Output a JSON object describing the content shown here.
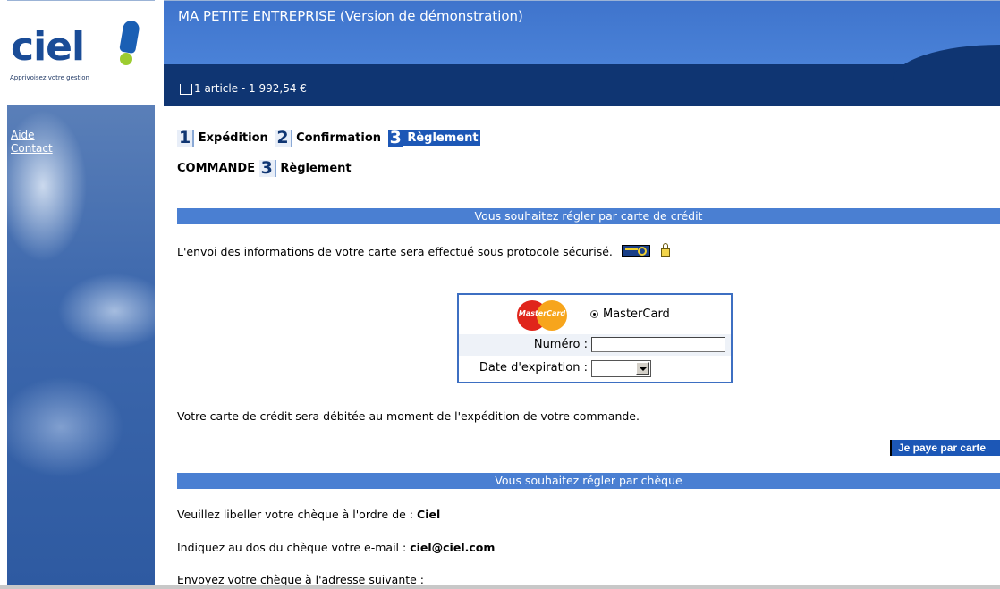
{
  "logo": {
    "word": "ciel",
    "tagline": "Apprivoisez votre gestion"
  },
  "header": {
    "title": "MA PETITE ENTREPRISE (Version de démonstration)",
    "cart": "1 article - 1 992,54 €"
  },
  "sidebar": {
    "links": [
      "Aide",
      "Contact"
    ]
  },
  "steps": [
    {
      "num": "1",
      "label": "Expédition"
    },
    {
      "num": "2",
      "label": "Confirmation"
    },
    {
      "num": "3",
      "label": "Règlement"
    }
  ],
  "command": {
    "prefix": "COMMANDE",
    "num": "3",
    "label": "Règlement"
  },
  "card_section": {
    "heading": "Vous souhaitez régler par carte de crédit",
    "secure_text": "L'envoi des informations de votre carte sera effectué sous protocole sécurisé.",
    "logo_text": "MasterCard",
    "radio_label": "MasterCard",
    "numero_label": "Numéro :",
    "numero_value": "",
    "expiry_label": "Date d'expiration :",
    "expiry_value": "",
    "debit_text": "Votre carte de crédit sera débitée au moment de l'expédition de votre commande.",
    "pay_button": "Je paye par carte"
  },
  "cheque_section": {
    "heading": "Vous souhaitez régler par chèque",
    "line1_prefix": "Veuillez libeller votre chèque à l'ordre de :",
    "line1_value": "Ciel",
    "line2_prefix": "Indiquez au dos du chèque votre e-mail :",
    "line2_value": "ciel@ciel.com",
    "line3": "Envoyez votre chèque à l'adresse suivante :"
  },
  "colors": {
    "header_blue": "#4a82d8",
    "header_dark": "#0f3572",
    "section_bar": "#4a7fd2",
    "button_blue": "#1c57b6"
  }
}
